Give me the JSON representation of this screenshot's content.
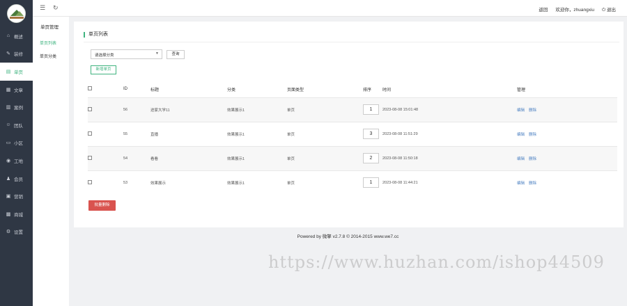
{
  "sidebar": {
    "items": [
      {
        "icon": "home-icon",
        "glyph": "⌂",
        "label": "概述"
      },
      {
        "icon": "brush-icon",
        "glyph": "✎",
        "label": "装修"
      },
      {
        "icon": "page-icon",
        "glyph": "▤",
        "label": "单页",
        "active": true
      },
      {
        "icon": "article-icon",
        "glyph": "▦",
        "label": "文章"
      },
      {
        "icon": "case-icon",
        "glyph": "▥",
        "label": "案例"
      },
      {
        "icon": "team-icon",
        "glyph": "☺",
        "label": "团队"
      },
      {
        "icon": "community-icon",
        "glyph": "▭",
        "label": "小区"
      },
      {
        "icon": "site-icon",
        "glyph": "◉",
        "label": "工地"
      },
      {
        "icon": "member-icon",
        "glyph": "♟",
        "label": "会员"
      },
      {
        "icon": "marketing-icon",
        "glyph": "▣",
        "label": "营销"
      },
      {
        "icon": "mall-icon",
        "glyph": "▩",
        "label": "商城"
      },
      {
        "icon": "settings-icon",
        "glyph": "⚙",
        "label": "设置"
      }
    ]
  },
  "subsidebar": {
    "heading": "单页管理",
    "items": [
      {
        "label": "单页列表",
        "active": true
      },
      {
        "label": "单页分类"
      }
    ]
  },
  "topbar": {
    "menu_icon": "☰",
    "refresh_icon": "↻",
    "back": "返回",
    "welcome": "欢迎你，zhuangxiu",
    "logout_icon": "⏻",
    "logout": "退出"
  },
  "panel": {
    "title": "单页列表",
    "select_value": "请选择分类",
    "query_label": "查询",
    "new_label": "新增单页",
    "batch_delete_label": "批量删除"
  },
  "table": {
    "headers": [
      "",
      "ID",
      "标题",
      "分类",
      "页面类型",
      "排序",
      "时间",
      "管理"
    ],
    "rows": [
      {
        "id": "56",
        "title": "途家大学11",
        "category": "效果展示1",
        "type": "单页",
        "sort": "1",
        "time": "2023-08-08 15:01:48"
      },
      {
        "id": "55",
        "title": "直播",
        "category": "效果展示1",
        "type": "单页",
        "sort": "3",
        "time": "2023-08-08 11:51:29"
      },
      {
        "id": "54",
        "title": "看看",
        "category": "效果展示1",
        "type": "单页",
        "sort": "2",
        "time": "2023-08-08 11:50:18"
      },
      {
        "id": "53",
        "title": "效果展示",
        "category": "效果展示1",
        "type": "单页",
        "sort": "1",
        "time": "2023-08-08 11:44:21"
      }
    ],
    "edit_label": "编辑",
    "delete_label": "删除"
  },
  "footer": "Powered by 微擎 v2.7.8 © 2014-2015 www.we7.cc",
  "watermark": "https://www.huzhan.com/ishop44509",
  "colors": {
    "accent": "#3fb37f",
    "sidebar_bg": "#2f3744",
    "danger": "#d9534f",
    "link": "#4a7fc1"
  }
}
